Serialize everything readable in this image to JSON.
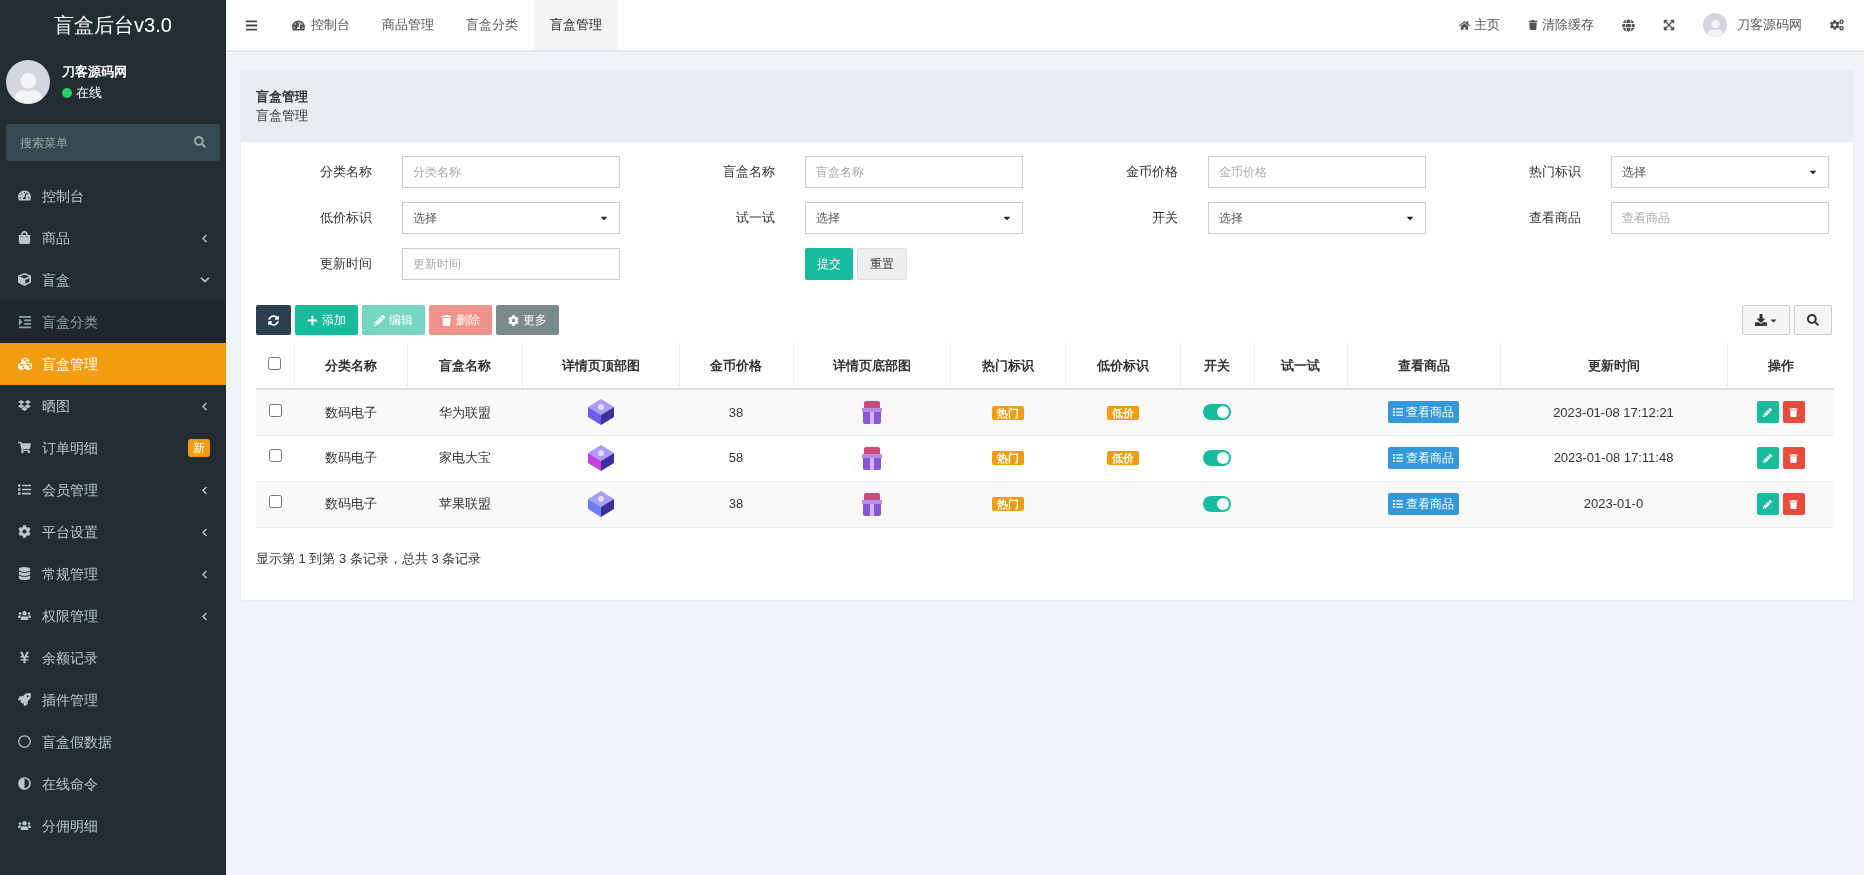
{
  "sidebar": {
    "title": "盲盒后台v3.0",
    "user": {
      "name": "刀客源码网",
      "status": "在线"
    },
    "search": {
      "placeholder": "搜索菜单"
    },
    "items": [
      {
        "label": "控制台",
        "kind": "link",
        "selected": false
      },
      {
        "label": "商品",
        "kind": "group",
        "expanded": false,
        "selected": false
      },
      {
        "label": "盲盒",
        "kind": "group",
        "expanded": true,
        "selected": false,
        "children": [
          {
            "label": "盲盒分类",
            "selected": false
          },
          {
            "label": "盲盒管理",
            "selected": true
          }
        ]
      },
      {
        "label": "晒图",
        "kind": "group",
        "expanded": false,
        "selected": false
      },
      {
        "label": "订单明细",
        "kind": "link",
        "selected": false,
        "badge": "新"
      },
      {
        "label": "会员管理",
        "kind": "group",
        "expanded": false,
        "selected": false
      },
      {
        "label": "平台设置",
        "kind": "group",
        "expanded": false,
        "selected": false
      },
      {
        "label": "常规管理",
        "kind": "group",
        "expanded": false,
        "selected": false
      },
      {
        "label": "权限管理",
        "kind": "group",
        "expanded": false,
        "selected": false
      },
      {
        "label": "余额记录",
        "kind": "link",
        "selected": false
      },
      {
        "label": "插件管理",
        "kind": "link",
        "selected": false
      },
      {
        "label": "盲盒假数据",
        "kind": "link",
        "selected": false
      },
      {
        "label": "在线命令",
        "kind": "link",
        "selected": false
      },
      {
        "label": "分佣明细",
        "kind": "link",
        "selected": false
      }
    ]
  },
  "topbar": {
    "tabs": [
      {
        "label": "控制台",
        "selected": false
      },
      {
        "label": "商品管理",
        "selected": false
      },
      {
        "label": "盲盒分类",
        "selected": false
      },
      {
        "label": "盲盒管理",
        "selected": true
      }
    ],
    "links": [
      "主页",
      "清除缓存"
    ],
    "user": "刀客源码网"
  },
  "breadcrumb": {
    "title": "盲盒管理",
    "subtitle": "盲盒管理"
  },
  "filters": [
    {
      "label": "分类名称",
      "kind": "text",
      "placeholder": "分类名称"
    },
    {
      "label": "盲盒名称",
      "kind": "text",
      "placeholder": "盲盒名称"
    },
    {
      "label": "金币价格",
      "kind": "text",
      "placeholder": "金币价格"
    },
    {
      "label": "热门标识",
      "kind": "select",
      "value": "选择"
    },
    {
      "label": "低价标识",
      "kind": "select",
      "value": "选择"
    },
    {
      "label": "试一试",
      "kind": "select",
      "value": "选择"
    },
    {
      "label": "开关",
      "kind": "select",
      "value": "选择"
    },
    {
      "label": "查看商品",
      "kind": "text",
      "placeholder": "查看商品"
    },
    {
      "label": "更新时间",
      "kind": "text",
      "placeholder": "更新时间"
    }
  ],
  "filter_buttons": [
    "提交",
    "重置"
  ],
  "toolbar": [
    {
      "kind": "refresh",
      "disabled": false
    },
    {
      "label": "添加",
      "kind": "add",
      "disabled": false
    },
    {
      "label": "编辑",
      "kind": "edit",
      "disabled": true
    },
    {
      "label": "删除",
      "kind": "delete",
      "disabled": true
    },
    {
      "label": "更多",
      "kind": "more",
      "disabled": false
    }
  ],
  "table": {
    "select_all": false,
    "columns": [
      "分类名称",
      "盲盒名称",
      "详情页顶部图",
      "金币价格",
      "详情页底部图",
      "热门标识",
      "低价标识",
      "开关",
      "试一试",
      "查看商品",
      "更新时间",
      "操作"
    ],
    "rows": [
      {
        "checked": false,
        "category": "数码电子",
        "name": "华为联盟",
        "price": "38",
        "hot": "热门",
        "low": "低价",
        "on": true,
        "view": "查看商品",
        "updated": "2023-01-08 17:12:21"
      },
      {
        "checked": false,
        "category": "数码电子",
        "name": "家电大宝",
        "price": "58",
        "hot": "热门",
        "low": "低价",
        "on": true,
        "view": "查看商品",
        "updated": "2023-01-08 17:11:48"
      },
      {
        "checked": false,
        "category": "数码电子",
        "name": "苹果联盟",
        "price": "38",
        "hot": "热门",
        "on": true,
        "view": "查看商品",
        "updated": "2023-01-0"
      }
    ]
  },
  "footer": "显示第 1 到第 3 条记录，总共 3 条记录"
}
